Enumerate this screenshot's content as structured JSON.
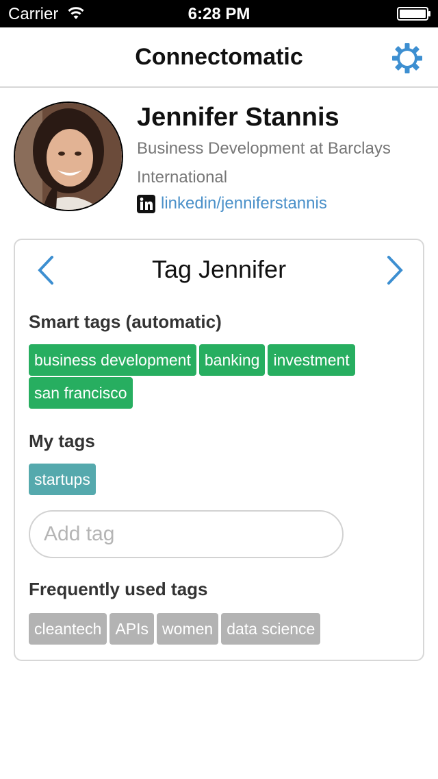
{
  "status_bar": {
    "carrier": "Carrier",
    "time": "6:28 PM"
  },
  "nav": {
    "title": "Connectomatic",
    "settings_icon": "gear-icon"
  },
  "profile": {
    "name": "Jennifer Stannis",
    "title": "Business Development at Barclays International",
    "linkedin_text": "linkedin/jenniferstannis"
  },
  "card": {
    "title": "Tag Jennifer",
    "smart_tags_label": "Smart tags (automatic)",
    "smart_tags": [
      "business development",
      "banking",
      "investment",
      "san francisco"
    ],
    "my_tags_label": "My tags",
    "my_tags": [
      "startups"
    ],
    "add_tag_placeholder": "Add tag",
    "frequent_label": "Frequently used tags",
    "frequent_tags": [
      "cleantech",
      "APIs",
      "women",
      "data science"
    ]
  },
  "colors": {
    "accent": "#4a90c9",
    "smart_tag": "#27ae60",
    "my_tag": "#55a9ad",
    "frequent_tag": "#b3b3b3"
  }
}
